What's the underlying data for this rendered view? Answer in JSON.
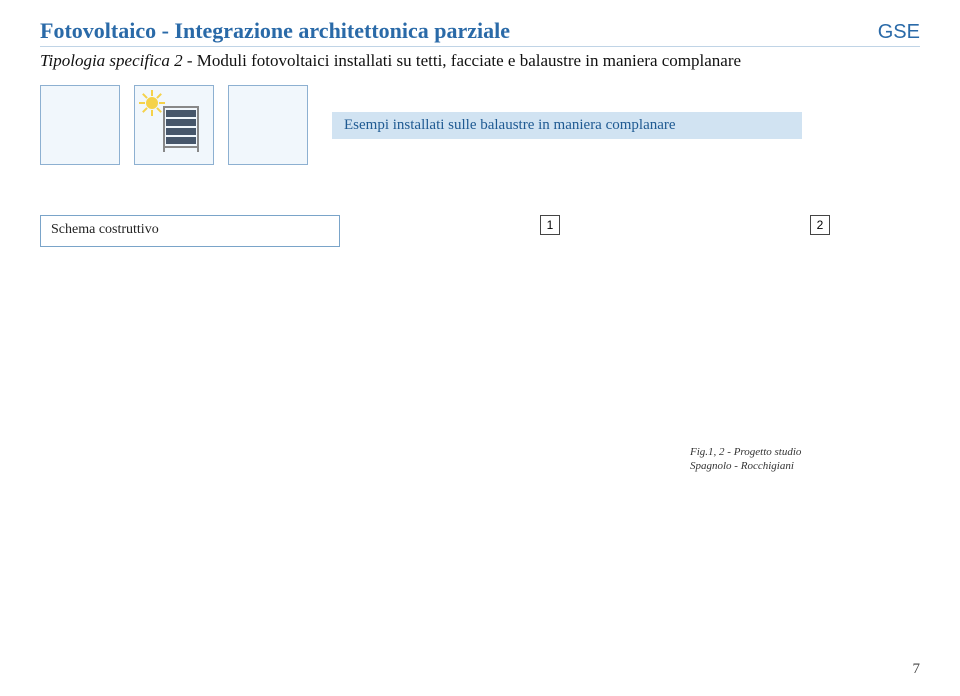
{
  "header": {
    "title": "Fotovoltaico - Integrazione architettonica parziale",
    "brand": "GSE"
  },
  "subtitle": {
    "prefix": "Tipologia specifica 2 - ",
    "text": "Moduli fotovoltaici installati su tetti, facciate e balaustre in maniera complanare"
  },
  "examples_label": "Esempi installati sulle balaustre in maniera complanare",
  "schema": {
    "label": "Schema costruttivo"
  },
  "figure_numbers": [
    "1",
    "2"
  ],
  "caption": {
    "line1": "Fig.1, 2 - Progetto studio",
    "line2": "Spagnolo - Rocchigiani"
  },
  "page_number": "7"
}
